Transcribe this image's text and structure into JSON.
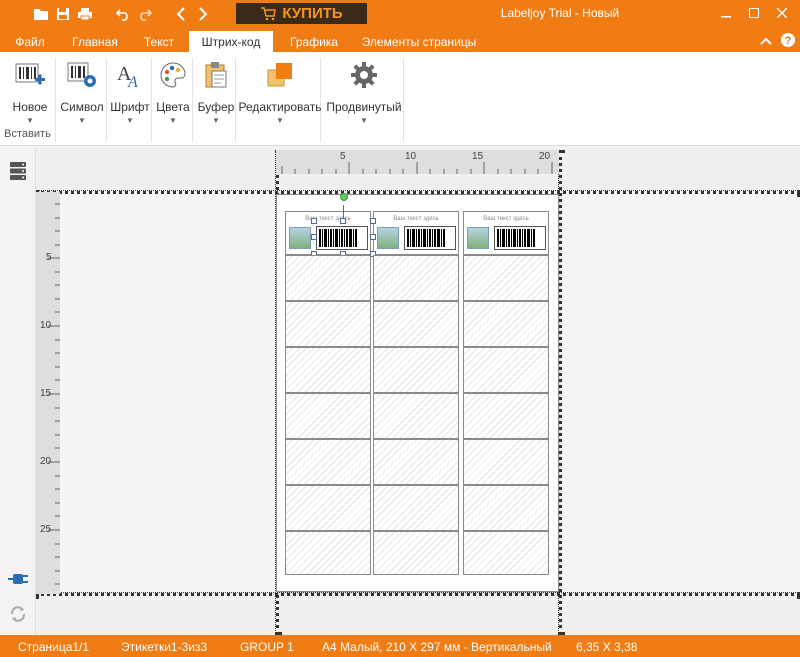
{
  "window": {
    "title": "Labeljoy Trial - Новый",
    "buy_label": "КУПИТЬ"
  },
  "tabs": [
    "Файл",
    "Главная",
    "Текст",
    "Штрих-код",
    "Графика",
    "Элементы страницы"
  ],
  "active_tab": "Штрих-код",
  "ribbon": {
    "new_label": "Новое",
    "insert_group_label": "Вставить",
    "symbol_label": "Символ",
    "font_label": "Шрифт",
    "colors_label": "Цвета",
    "buffer_label": "Буфер",
    "edit_label": "Редактировать",
    "advanced_label": "Продвинутый"
  },
  "ruler": {
    "h_marks": [
      "5",
      "10",
      "15",
      "20"
    ],
    "v_marks": [
      "5",
      "10",
      "15",
      "20",
      "25"
    ]
  },
  "label": {
    "placeholder_text": "Ваш текст здесь"
  },
  "status": {
    "page": "Страница1/1",
    "labels": "Этикетки1-3из3",
    "group": "GROUP 1",
    "paper": "A4 Малый, 210 X 297 мм - Вертикальный",
    "size": "6,35 X 3,38"
  },
  "colors": {
    "accent": "#f07c13",
    "buy_background": "#3a2a1a"
  }
}
